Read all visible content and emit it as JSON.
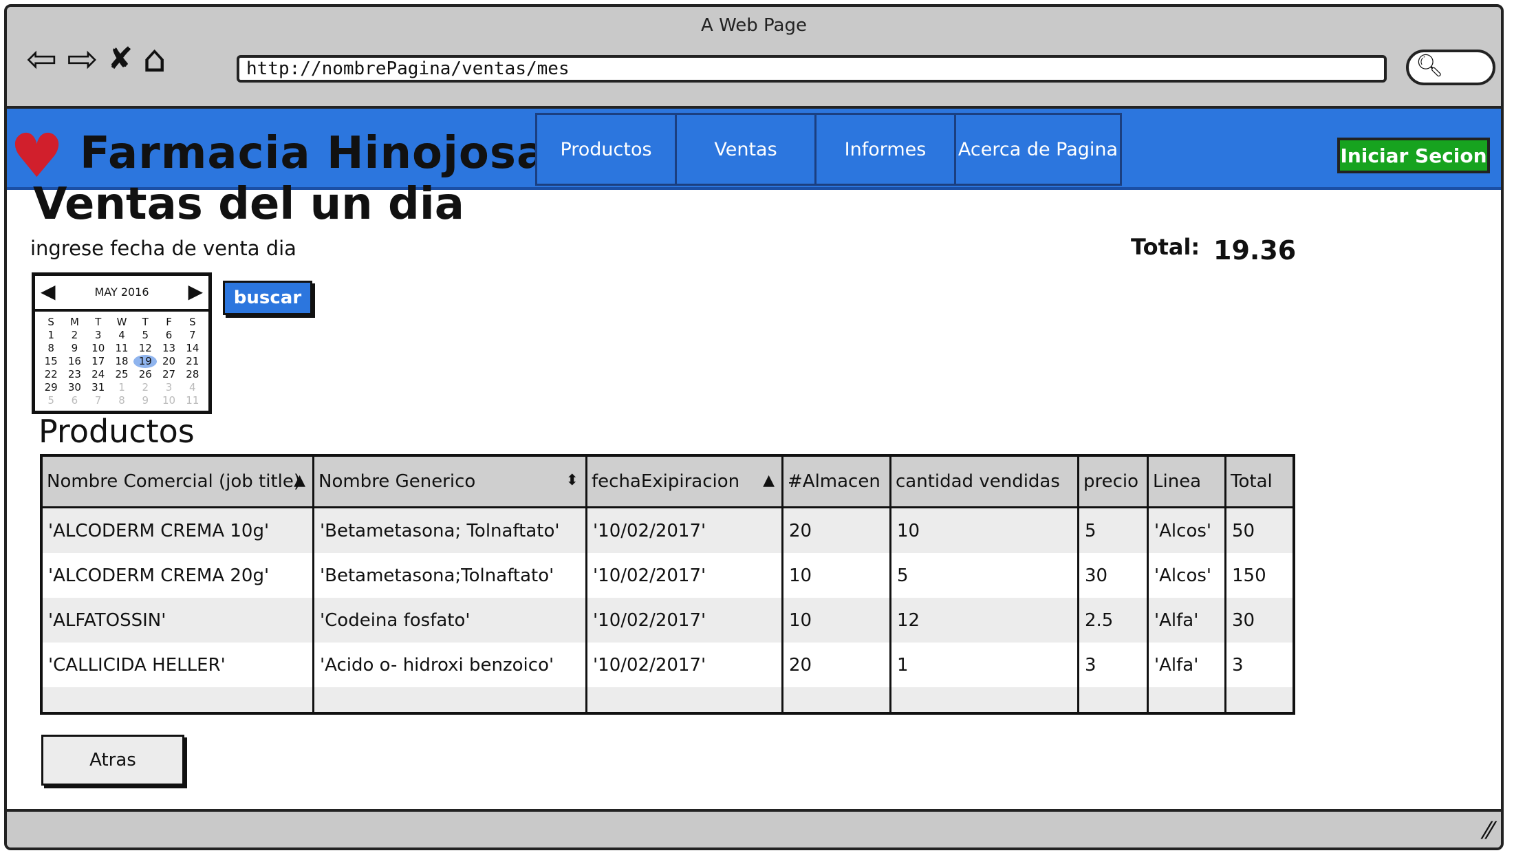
{
  "window": {
    "title": "A Web Page",
    "url": "http://nombrePagina/ventas/mes"
  },
  "app": {
    "brand": "Farmacia Hinojosa",
    "tabs": [
      "Productos",
      "Ventas",
      "Informes",
      "Acerca de Pagina"
    ],
    "login_label": "Iniciar Secion"
  },
  "page": {
    "title": "Ventas del un dia",
    "instruction": "ingrese fecha de venta dia",
    "total_label": "Total:",
    "total_value": "19.36",
    "search_label": "buscar",
    "section_title": "Productos",
    "back_label": "Atras"
  },
  "calendar": {
    "month": "MAY 2016",
    "weekdays": [
      "S",
      "M",
      "T",
      "W",
      "T",
      "F",
      "S"
    ],
    "weeks": [
      [
        "1",
        "2",
        "3",
        "4",
        "5",
        "6",
        "7"
      ],
      [
        "8",
        "9",
        "10",
        "11",
        "12",
        "13",
        "14"
      ],
      [
        "15",
        "16",
        "17",
        "18",
        "19",
        "20",
        "21"
      ],
      [
        "22",
        "23",
        "24",
        "25",
        "26",
        "27",
        "28"
      ],
      [
        "29",
        "30",
        "31",
        "1",
        "2",
        "3",
        "4"
      ],
      [
        "5",
        "6",
        "7",
        "8",
        "9",
        "10",
        "11"
      ]
    ],
    "selected_day": "19"
  },
  "table": {
    "headers": [
      "Nombre Comercial (job title)",
      "Nombre Generico",
      "fechaExipiracion",
      "#Almacen",
      "cantidad vendidas",
      "precio",
      "Linea",
      "Total"
    ],
    "rows": [
      [
        "'ALCODERM CREMA 10g'",
        "'Betametasona; Tolnaftato'",
        "'10/02/2017'",
        "20",
        "10",
        "5",
        "'Alcos'",
        "50"
      ],
      [
        "'ALCODERM CREMA 20g'",
        "'Betametasona;Tolnaftato'",
        "'10/02/2017'",
        "10",
        "5",
        "30",
        "'Alcos'",
        "150"
      ],
      [
        "'ALFATOSSIN'",
        "'Codeina fosfato'",
        "'10/02/2017'",
        "10",
        "12",
        "2.5",
        "'Alfa'",
        "30"
      ],
      [
        "'CALLICIDA HELLER'",
        "'Acido o- hidroxi benzoico'",
        "'10/02/2017'",
        "20",
        "1",
        "3",
        "'Alfa'",
        "3"
      ]
    ]
  }
}
